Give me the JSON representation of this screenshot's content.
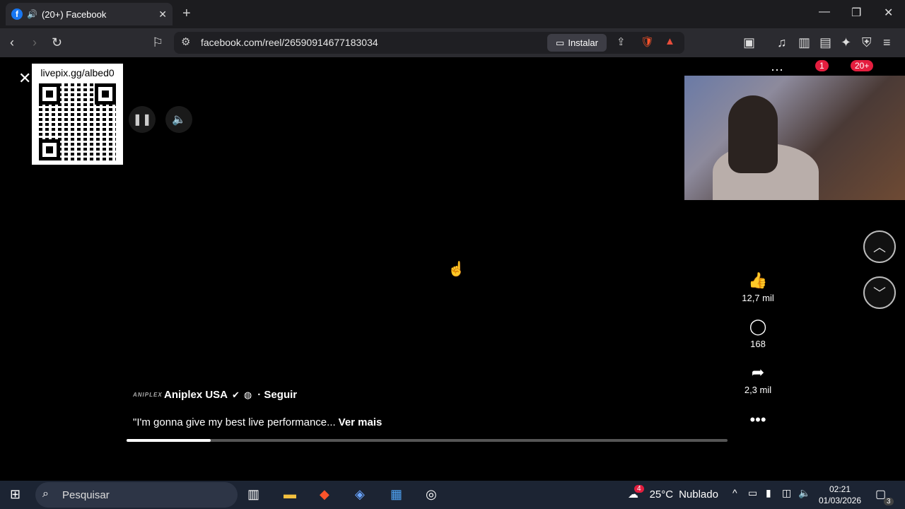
{
  "browser": {
    "tab_title": "(20+) Facebook",
    "url": "facebook.com/reel/26590914677183034",
    "install_label": "Instalar"
  },
  "overlay": {
    "qr_label": "livepix.gg/albed0"
  },
  "notifications": {
    "messenger_badge": "1",
    "notif_badge": "20+"
  },
  "reel": {
    "likes": "12,7 mil",
    "comments": "168",
    "shares": "2,3 mil",
    "author_logo": "ANIPLEX",
    "author": "Aniplex USA",
    "follow": "· Seguir",
    "caption": "\"I'm gonna give my best live performance...",
    "see_more": "Ver mais",
    "progress_percent": 14
  },
  "taskbar": {
    "search_placeholder": "Pesquisar",
    "weather_badge": "4",
    "temperature": "25°C",
    "weather": "Nublado",
    "time": "02:21",
    "date": "01/03/2026",
    "notification_count": "3"
  },
  "icons": [
    "facebook-icon",
    "speaker-icon",
    "close-icon",
    "plus-icon",
    "back-icon",
    "forward-icon",
    "reload-icon",
    "bookmark-icon",
    "site-info-icon",
    "install-icon",
    "share-icon",
    "brave-shield-icon",
    "brave-rewards-icon",
    "qr-code",
    "pause-icon",
    "volume-icon",
    "like-icon",
    "comment-icon",
    "share-reel-icon",
    "more-icon",
    "chevron-up-icon",
    "chevron-down-icon",
    "windows-icon",
    "search-icon"
  ]
}
